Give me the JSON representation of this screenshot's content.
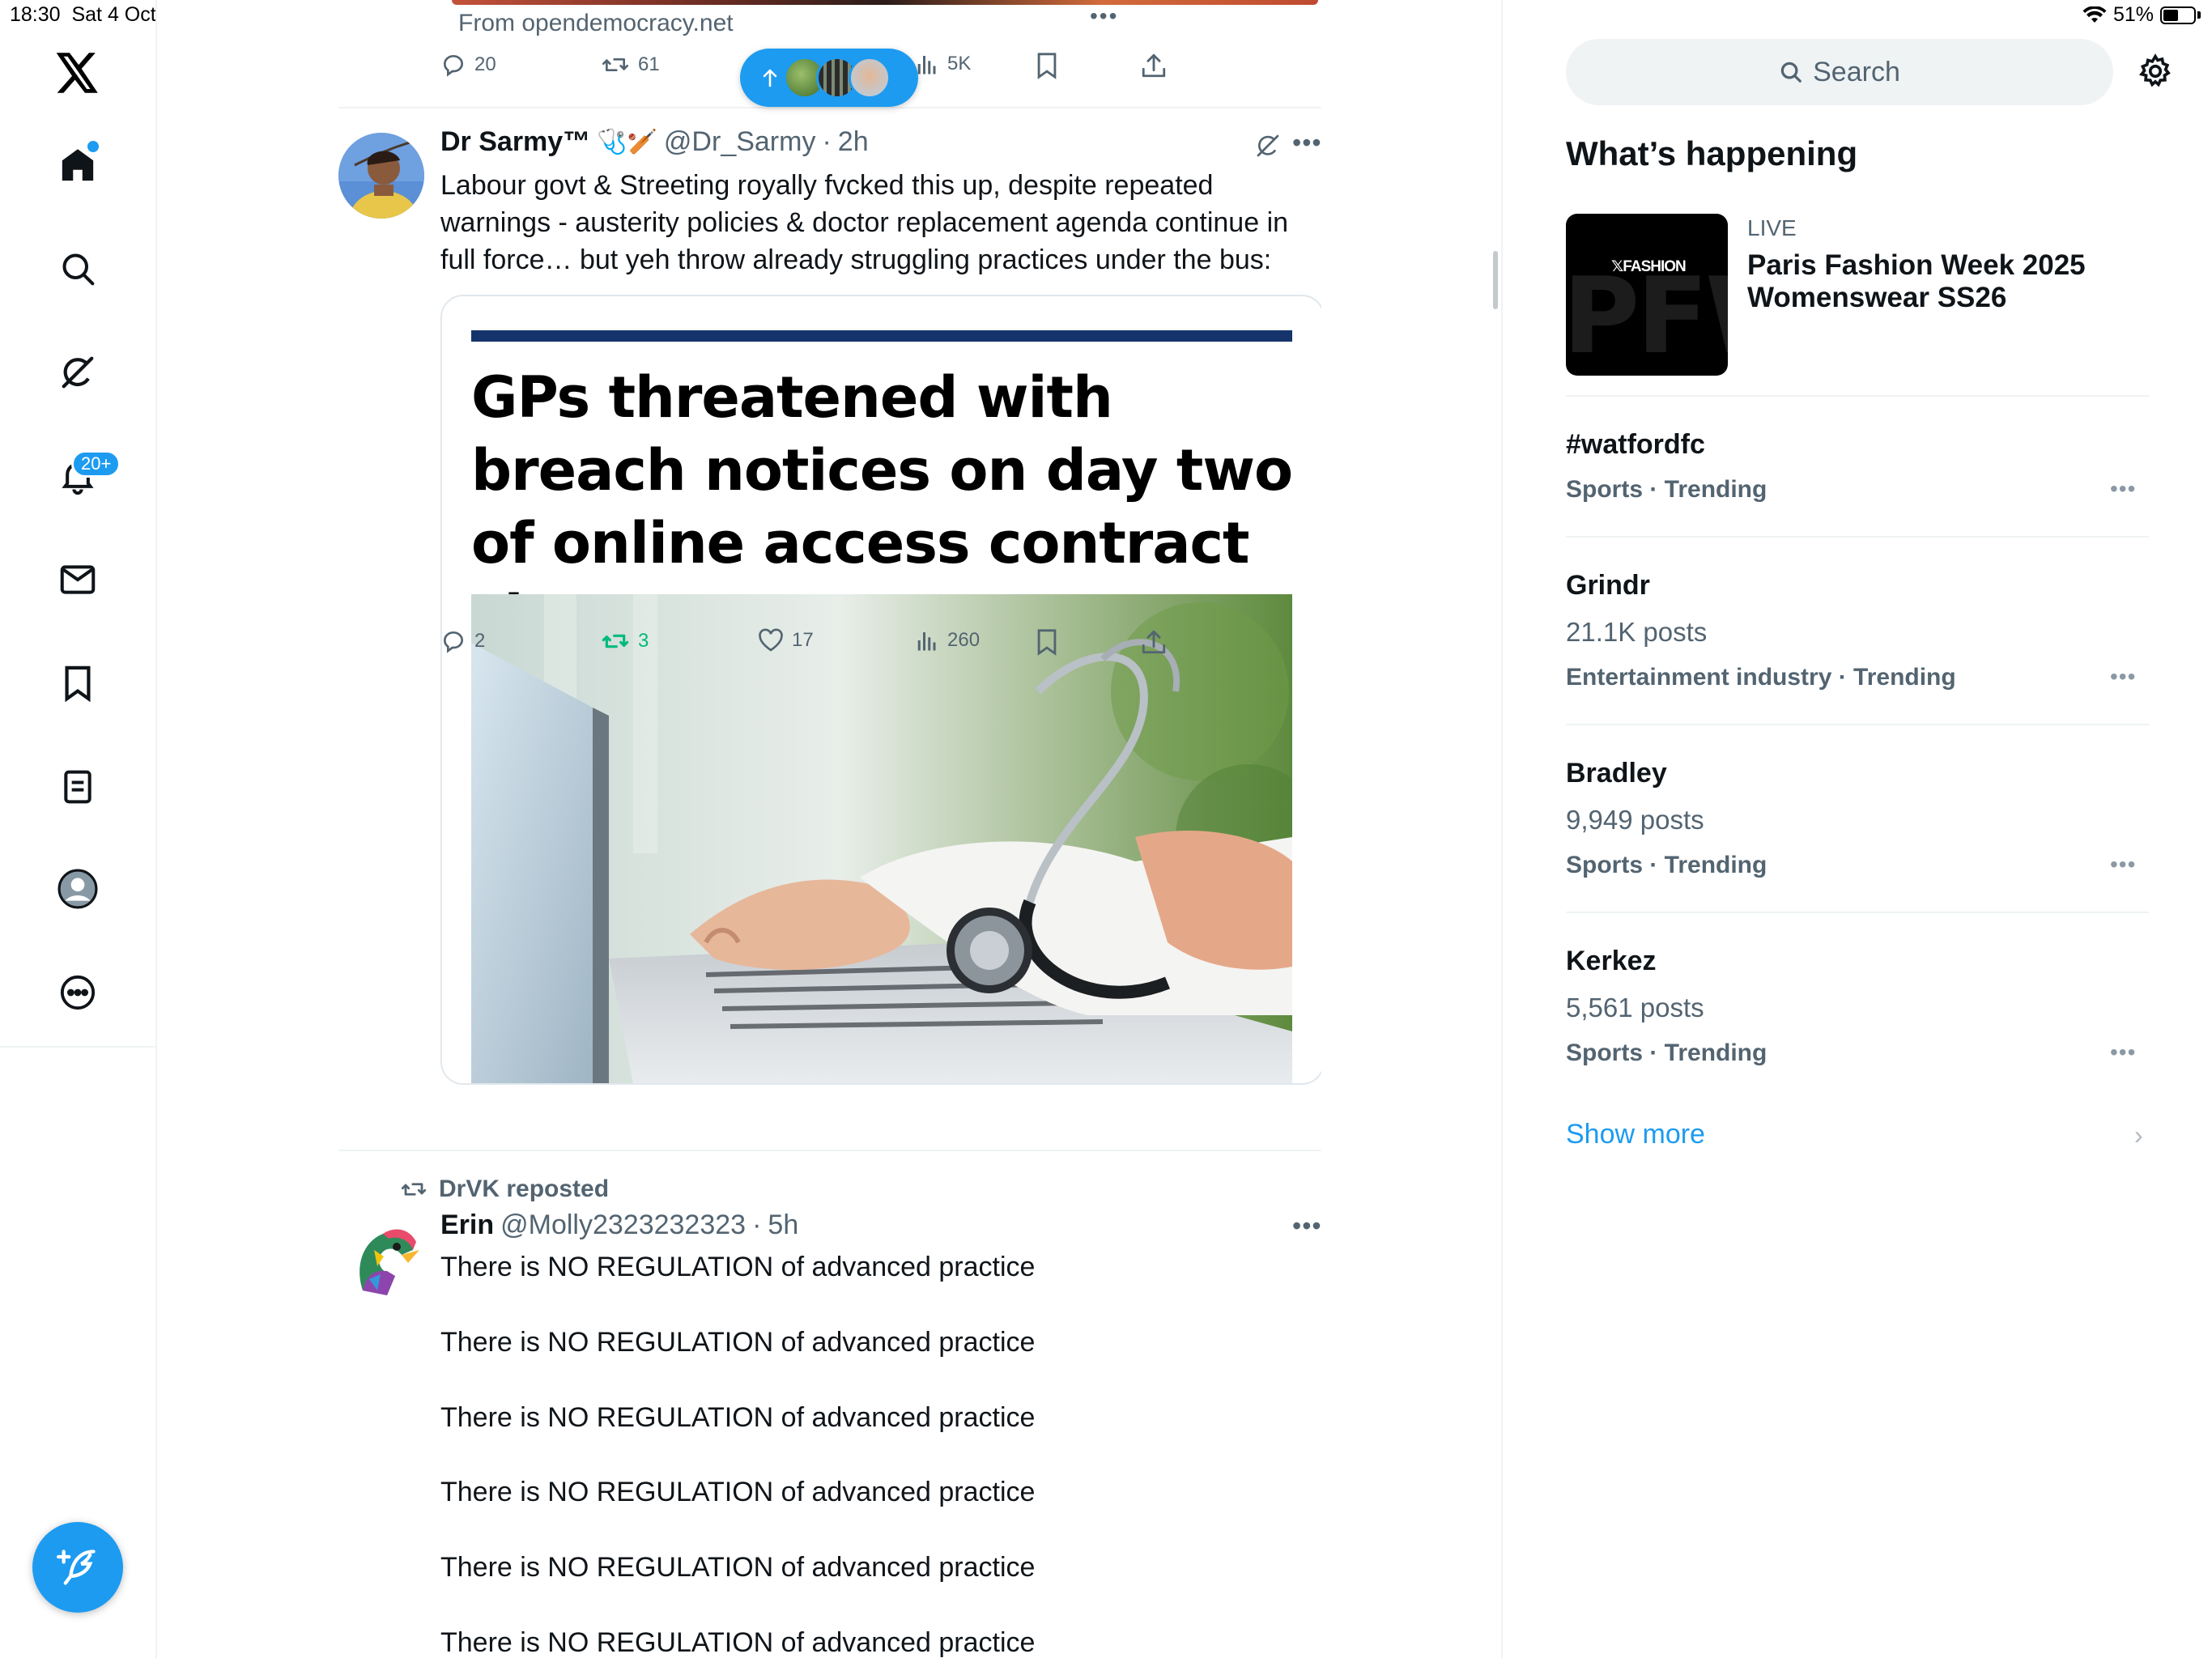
{
  "status_bar": {
    "time": "18:30",
    "date": "Sat 4 Oct",
    "battery": "51%",
    "battery_level": 0.51
  },
  "nav": {
    "notifications_badge": "20+",
    "items": [
      "home-icon",
      "explore-icon",
      "grok-icon",
      "notifications-icon",
      "messages-icon",
      "bookmarks-icon",
      "lists-icon",
      "profile-icon",
      "more-icon"
    ]
  },
  "prev_tweet": {
    "source": "From opendemocracy.net",
    "stats": {
      "replies": "20",
      "reposts": "61",
      "views": "5K"
    }
  },
  "tweet1": {
    "name": "Dr Sarmy™",
    "emoji": "🩺🏏",
    "handle": "@Dr_Sarmy",
    "time": "2h",
    "text": "Labour govt & Streeting royally fvcked this up, despite repeated warnings - austerity policies & doctor replacement agenda continue in full force… but yeh throw already struggling practices under the bus:",
    "card_headline": "GPs threatened with breach notices on day two of online access contract change",
    "stats": {
      "replies": "2",
      "reposts": "3",
      "likes": "17",
      "views": "260"
    }
  },
  "tweet2": {
    "reposted_by": "DrVK reposted",
    "name": "Erin",
    "handle": "@Molly2323232323",
    "time": "5h",
    "lines": [
      "There is NO REGULATION of advanced practice",
      "There is NO REGULATION of advanced practice",
      "There is NO REGULATION of advanced practice",
      "There is NO REGULATION of advanced practice",
      "There is NO REGULATION of advanced practice",
      "There is NO REGULATION of advanced practice"
    ]
  },
  "sidebar": {
    "search_placeholder": "Search",
    "heading": "What’s happening",
    "live": {
      "brand": "𝕏FASHION",
      "bg_text": "PFW",
      "label": "LIVE",
      "title": "Paris Fashion Week 2025 Womenswear SS26"
    },
    "trends": [
      {
        "name": "#watfordfc",
        "posts": "",
        "meta": "Sports · Trending"
      },
      {
        "name": "Grindr",
        "posts": "21.1K posts",
        "meta": "Entertainment industry · Trending"
      },
      {
        "name": "Bradley",
        "posts": "9,949 posts",
        "meta": "Sports · Trending"
      },
      {
        "name": "Kerkez",
        "posts": "5,561 posts",
        "meta": "Sports · Trending"
      }
    ],
    "show_more": "Show more"
  },
  "colors": {
    "accent": "#1d9bf0",
    "repost_green": "#00ba7c",
    "text": "#0f1419",
    "muted": "#536471"
  }
}
